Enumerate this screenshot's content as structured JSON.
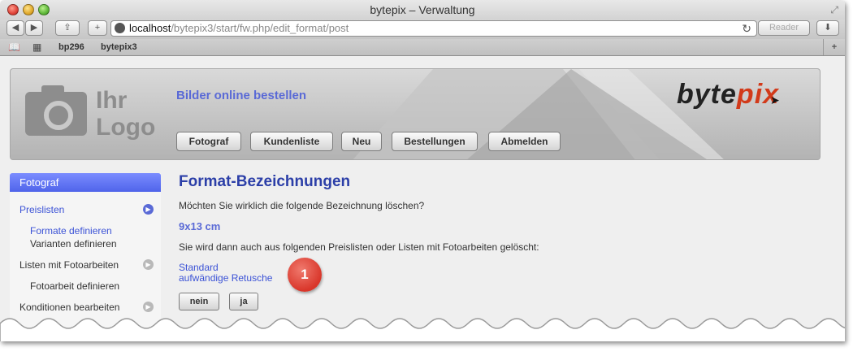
{
  "window": {
    "title": "bytepix – Verwaltung"
  },
  "toolbar": {
    "url_host": "localhost",
    "url_path": "/bytepix3/start/fw.php/edit_format/post",
    "reader_label": "Reader"
  },
  "bookmarks": [
    "bp296",
    "bytepix3"
  ],
  "header": {
    "logo_text": [
      "Ihr",
      "Logo"
    ],
    "tagline": "Bilder online bestellen",
    "brand_main": "byte",
    "brand_accent": "pix",
    "nav": [
      "Fotograf",
      "Kundenliste",
      "Neu",
      "Bestellungen",
      "Abmelden"
    ]
  },
  "sidebar": {
    "heading": "Fotograf",
    "items": [
      {
        "label": "Preislisten",
        "subs": [
          "Formate definieren",
          "Varianten definieren"
        ]
      },
      {
        "label": "Listen mit Fotoarbeiten",
        "subs": [
          "Fotoarbeit definieren"
        ]
      },
      {
        "label": "Konditionen bearbeiten",
        "subs": []
      }
    ]
  },
  "main": {
    "title": "Format-Bezeichnungen",
    "question": "Möchten Sie wirklich die folgende Bezeichnung löschen?",
    "format_name": "9x13 cm",
    "info": "Sie wird dann auch aus folgenden Preislisten oder Listen mit Fotoarbeiten gelöscht:",
    "links": [
      "Standard",
      "aufwändige Retusche"
    ],
    "badge": "1",
    "no_label": "nein",
    "yes_label": "ja"
  }
}
